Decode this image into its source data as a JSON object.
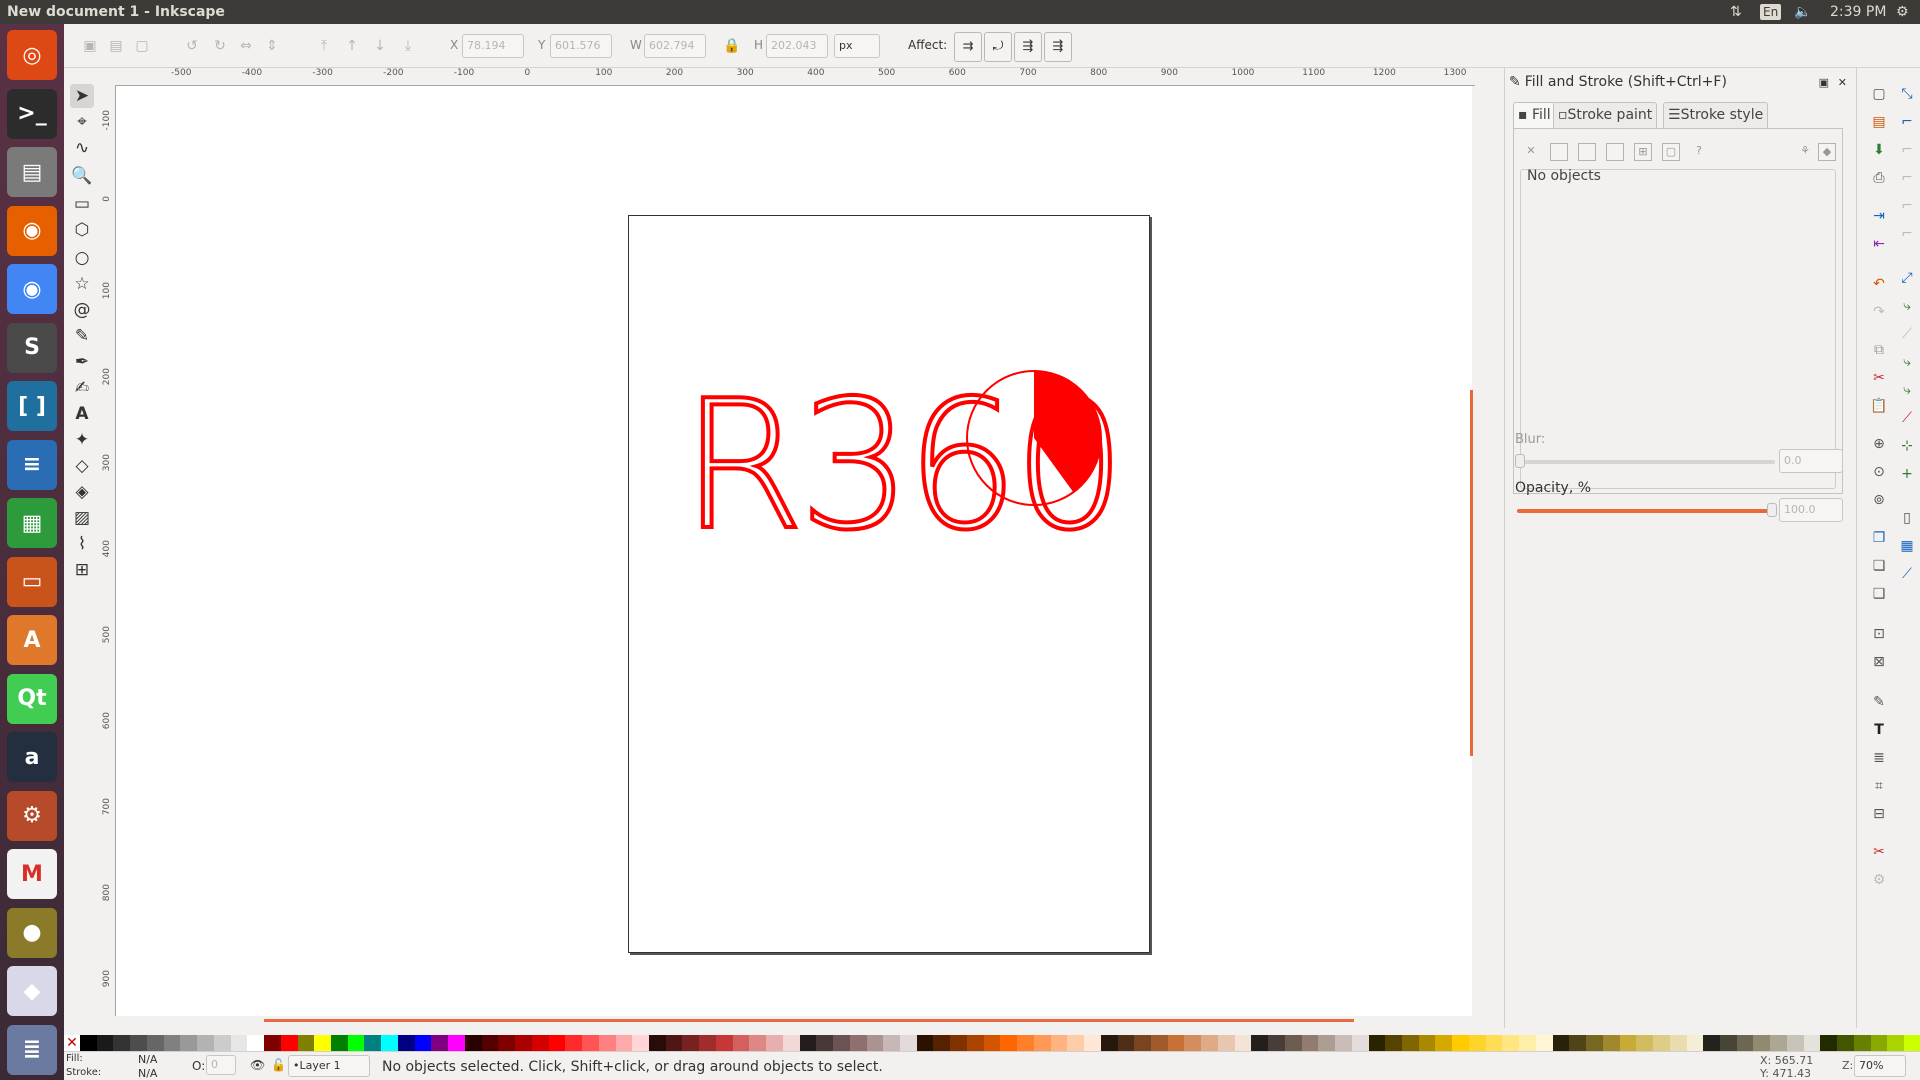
{
  "window": {
    "title": "New document 1 - Inkscape"
  },
  "topbar": {
    "time": "2:39 PM",
    "lang": "En"
  },
  "launcher": {
    "items": [
      {
        "name": "ubuntu-icon",
        "glyph": "◎",
        "color": "#dd4814"
      },
      {
        "name": "terminal-icon",
        "glyph": ">_",
        "color": "#2c2c2c"
      },
      {
        "name": "file-manager-icon",
        "glyph": "▤",
        "color": "#7a7a7a"
      },
      {
        "name": "firefox-icon",
        "glyph": "◉",
        "color": "#e66000"
      },
      {
        "name": "chrome-icon",
        "glyph": "◉",
        "color": "#4285f4"
      },
      {
        "name": "sublime-icon",
        "glyph": "S",
        "color": "#4a4a4a"
      },
      {
        "name": "bracket-app-icon",
        "glyph": "[ ]",
        "color": "#1f6f9f"
      },
      {
        "name": "writer-icon",
        "glyph": "≡",
        "color": "#2a6db5"
      },
      {
        "name": "calc-icon",
        "glyph": "▦",
        "color": "#2d9b3b"
      },
      {
        "name": "impress-icon",
        "glyph": "▭",
        "color": "#c9541b"
      },
      {
        "name": "software-center-icon",
        "glyph": "A",
        "color": "#e0782c"
      },
      {
        "name": "qt-icon",
        "glyph": "Qt",
        "color": "#41cd52"
      },
      {
        "name": "amazon-icon",
        "glyph": "a",
        "color": "#232f3e"
      },
      {
        "name": "settings-icon",
        "glyph": "⚙",
        "color": "#b74a2a"
      },
      {
        "name": "gmail-icon",
        "glyph": "M",
        "color": "#f2f2f2"
      },
      {
        "name": "app-icon",
        "glyph": "●",
        "color": "#8a7a2a"
      },
      {
        "name": "inkscape-icon",
        "glyph": "◆",
        "color": "#d8d8e8"
      },
      {
        "name": "stack-icon",
        "glyph": "≣",
        "color": "#6a7aa0"
      }
    ]
  },
  "commandbar": {
    "x_label": "X",
    "x_value": "78.194",
    "y_label": "Y",
    "y_value": "601.576",
    "w_label": "W",
    "w_value": "602.794",
    "h_label": "H",
    "h_value": "202.043",
    "unit": "px",
    "affect_label": "Affect:"
  },
  "ruler": {
    "h_labels": [
      "-500",
      "-400",
      "-300",
      "-200",
      "-100",
      "0",
      "100",
      "200",
      "300",
      "400",
      "500",
      "600",
      "700",
      "800",
      "900",
      "1000",
      "1100",
      "1200",
      "1300"
    ],
    "v_labels": [
      "-100",
      "0",
      "100",
      "200",
      "300",
      "400",
      "500",
      "600",
      "700",
      "800",
      "900"
    ]
  },
  "artwork": {
    "text": "R360",
    "color": "#ff0000",
    "pie_fraction": 0.4
  },
  "dock": {
    "title": "Fill and Stroke (Shift+Ctrl+F)",
    "tabs": [
      "Fill",
      "Stroke paint",
      "Stroke style"
    ],
    "no_objects": "No objects",
    "blur_label": "Blur:",
    "blur_value": "0.0",
    "opacity_label": "Opacity, %",
    "opacity_value": "100.0"
  },
  "palette": [
    "#000000",
    "#1a1a1a",
    "#333333",
    "#4d4d4d",
    "#666666",
    "#808080",
    "#999999",
    "#b3b3b3",
    "#cccccc",
    "#e6e6e6",
    "#ffffff",
    "#800000",
    "#ff0000",
    "#808000",
    "#ffff00",
    "#008000",
    "#00ff00",
    "#008080",
    "#00ffff",
    "#000080",
    "#0000ff",
    "#800080",
    "#ff00ff",
    "#2b0000",
    "#550000",
    "#800000",
    "#aa0000",
    "#d40000",
    "#ff0000",
    "#ff2a2a",
    "#ff5555",
    "#ff8080",
    "#ffaaaa",
    "#ffd5d5",
    "#280b0b",
    "#501616",
    "#782121",
    "#a02c2c",
    "#c83737",
    "#d35f5f",
    "#de8787",
    "#e9afaf",
    "#f4d7d7",
    "#241c1c",
    "#483737",
    "#6c5353",
    "#916f6f",
    "#ac9393",
    "#c8b7b7",
    "#e3dbdb",
    "#2b1100",
    "#552200",
    "#803300",
    "#aa4400",
    "#d45500",
    "#ff6600",
    "#ff7f2a",
    "#ff9955",
    "#ffb380",
    "#ffccaa",
    "#ffe6d5",
    "#28170b",
    "#502d16",
    "#784421",
    "#a05a2c",
    "#c87137",
    "#d38d5f",
    "#deaa87",
    "#e9c6af",
    "#f4e3d7",
    "#241f1c",
    "#483e37",
    "#6c5d53",
    "#917c6f",
    "#ac9d93",
    "#c8beb7",
    "#e3dedb",
    "#2b2200",
    "#554400",
    "#806600",
    "#aa8800",
    "#d4aa00",
    "#ffcc00",
    "#ffd42a",
    "#ffdd55",
    "#ffe680",
    "#ffeeaa",
    "#fff6d5",
    "#28220b",
    "#504416",
    "#786721",
    "#a0892c",
    "#c8ab37",
    "#d3bc5f",
    "#decd87",
    "#e9ddaf",
    "#f4eed7",
    "#24221c",
    "#484537",
    "#6c6753",
    "#918a6f",
    "#aca793",
    "#c8c4b7",
    "#e3e2db",
    "#222b00",
    "#445500",
    "#668000",
    "#88aa00",
    "#aad400",
    "#ccff00"
  ],
  "status": {
    "fill_label": "Fill:",
    "fill_value": "N/A",
    "stroke_label": "Stroke:",
    "stroke_value": "N/A",
    "o_label": "O:",
    "o_value": "0",
    "layer": "•Layer 1",
    "message": "No objects selected. Click, Shift+click, or drag around objects to select.",
    "x_coord": "X: 565.71",
    "y_coord": "Y: 471.43",
    "z_label": "Z:",
    "zoom": "70%"
  }
}
